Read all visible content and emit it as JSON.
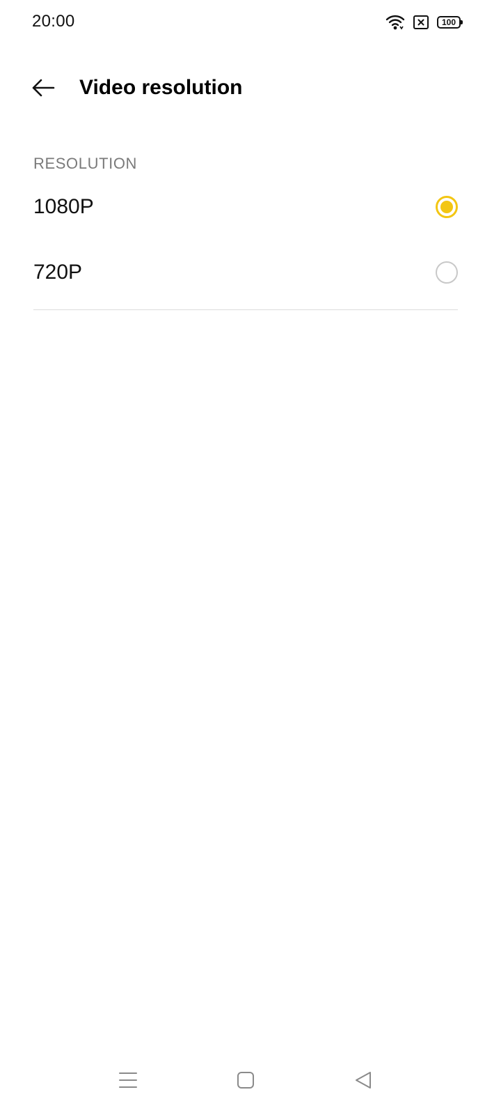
{
  "status_bar": {
    "time": "20:00",
    "battery_level": "100",
    "icons": [
      "wifi-icon",
      "sim-x-icon",
      "battery-icon"
    ]
  },
  "app_bar": {
    "back_icon": "arrow-left-icon",
    "title": "Video resolution"
  },
  "section": {
    "header": "RESOLUTION",
    "options": [
      {
        "label": "1080P",
        "selected": true
      },
      {
        "label": "720P",
        "selected": false
      }
    ]
  },
  "nav_bar": {
    "icons": [
      "menu-icon",
      "home-icon",
      "back-triangle-icon"
    ]
  },
  "colors": {
    "accent": "#f3c613",
    "radio_unselected": "#c8c8c8",
    "section_header": "#7a7a7a",
    "divider": "#dcdcdc",
    "nav_icon": "#8a8a8a"
  }
}
